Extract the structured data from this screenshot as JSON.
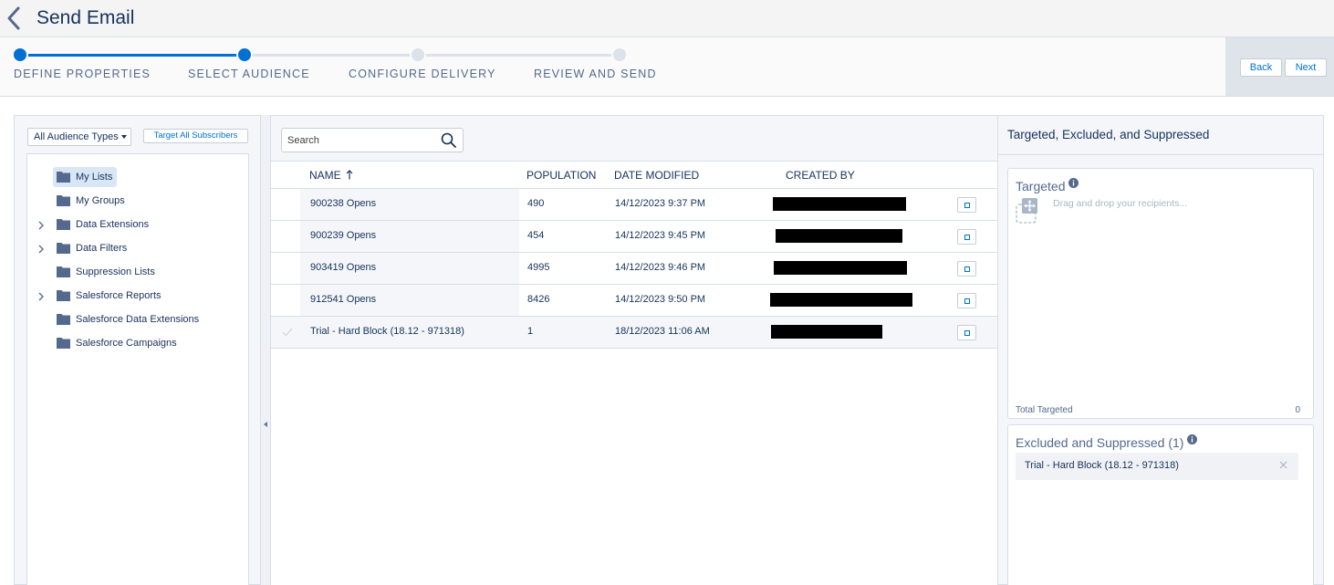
{
  "header": {
    "title": "Send Email"
  },
  "wizard": {
    "steps": [
      {
        "label": "DEFINE PROPERTIES",
        "state": "complete"
      },
      {
        "label": "SELECT AUDIENCE",
        "state": "current"
      },
      {
        "label": "CONFIGURE DELIVERY",
        "state": "pending"
      },
      {
        "label": "REVIEW AND SEND",
        "state": "pending"
      }
    ],
    "back_label": "Back",
    "next_label": "Next"
  },
  "left": {
    "audience_type": "All Audience Types",
    "target_all_label": "Target All Subscribers",
    "tree": [
      {
        "label": "My Lists",
        "expandable": false,
        "selected": true
      },
      {
        "label": "My Groups",
        "expandable": false,
        "selected": false
      },
      {
        "label": "Data Extensions",
        "expandable": true,
        "selected": false
      },
      {
        "label": "Data Filters",
        "expandable": true,
        "selected": false
      },
      {
        "label": "Suppression Lists",
        "expandable": false,
        "selected": false
      },
      {
        "label": "Salesforce Reports",
        "expandable": true,
        "selected": false
      },
      {
        "label": "Salesforce Data Extensions",
        "expandable": false,
        "selected": false
      },
      {
        "label": "Salesforce Campaigns",
        "expandable": false,
        "selected": false
      }
    ]
  },
  "center": {
    "search_placeholder": "Search",
    "columns": {
      "name": "NAME",
      "population": "POPULATION",
      "date_modified": "DATE MODIFIED",
      "created_by": "CREATED BY"
    },
    "sort": {
      "column": "name",
      "direction": "ascending"
    },
    "rows": [
      {
        "name": "900238 Opens",
        "population": "490",
        "date_modified": "14/12/2023 9:37 PM",
        "created_by_redacted": true,
        "checked": false
      },
      {
        "name": "900239 Opens",
        "population": "454",
        "date_modified": "14/12/2023 9:45 PM",
        "created_by_redacted": true,
        "checked": false
      },
      {
        "name": "903419 Opens",
        "population": "4995",
        "date_modified": "14/12/2023 9:46 PM",
        "created_by_redacted": true,
        "checked": false
      },
      {
        "name": "912541 Opens",
        "population": "8426",
        "date_modified": "14/12/2023 9:50 PM",
        "created_by_redacted": true,
        "checked": false
      },
      {
        "name": "Trial - Hard Block (18.12 - 971318)",
        "population": "1",
        "date_modified": "18/12/2023 11:06 AM",
        "created_by_redacted": true,
        "checked": true
      }
    ]
  },
  "right": {
    "title": "Targeted, Excluded, and Suppressed",
    "targeted": {
      "heading": "Targeted",
      "placeholder": "Drag and drop your recipients...",
      "total_label": "Total Targeted",
      "total_value": "0"
    },
    "excluded": {
      "heading": "Excluded and Suppressed (1)",
      "items": [
        {
          "label": "Trial - Hard Block (18.12 - 971318)"
        }
      ]
    }
  },
  "colors": {
    "accent": "#0070d2",
    "text": "#16325c",
    "muted": "#54698d",
    "border": "#d8dde6",
    "panel": "#f4f6f9"
  }
}
